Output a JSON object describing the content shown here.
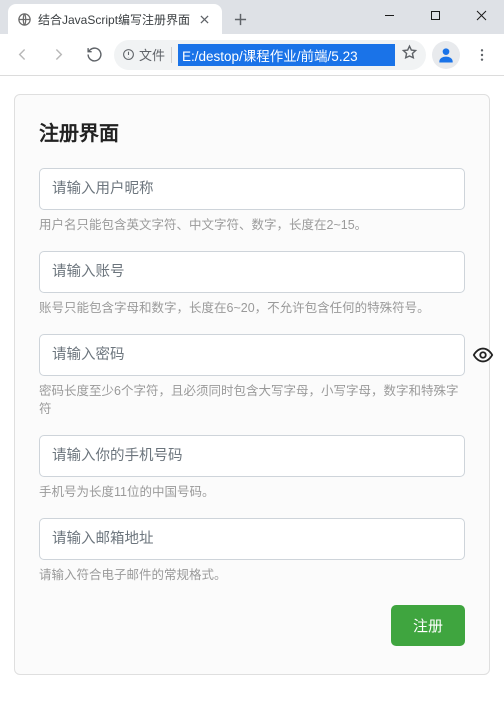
{
  "browser": {
    "tab_title": "结合JavaScript编写注册界面",
    "address_label": "文件",
    "url": "E:/destop/课程作业/前端/5.23"
  },
  "form": {
    "title": "注册界面",
    "nickname": {
      "placeholder": "请输入用户昵称",
      "hint": "用户名只能包含英文字符、中文字符、数字，长度在2~15。"
    },
    "account": {
      "placeholder": "请输入账号",
      "hint": "账号只能包含字母和数字，长度在6~20，不允许包含任何的特殊符号。"
    },
    "password": {
      "placeholder": "请输入密码",
      "hint": "密码长度至少6个字符，且必须同时包含大写字母，小写字母，数字和特殊字符"
    },
    "phone": {
      "placeholder": "请输入你的手机号码",
      "hint": "手机号为长度11位的中国号码。"
    },
    "email": {
      "placeholder": "请输入邮箱地址",
      "hint": "请输入符合电子邮件的常规格式。"
    },
    "submit_label": "注册"
  }
}
